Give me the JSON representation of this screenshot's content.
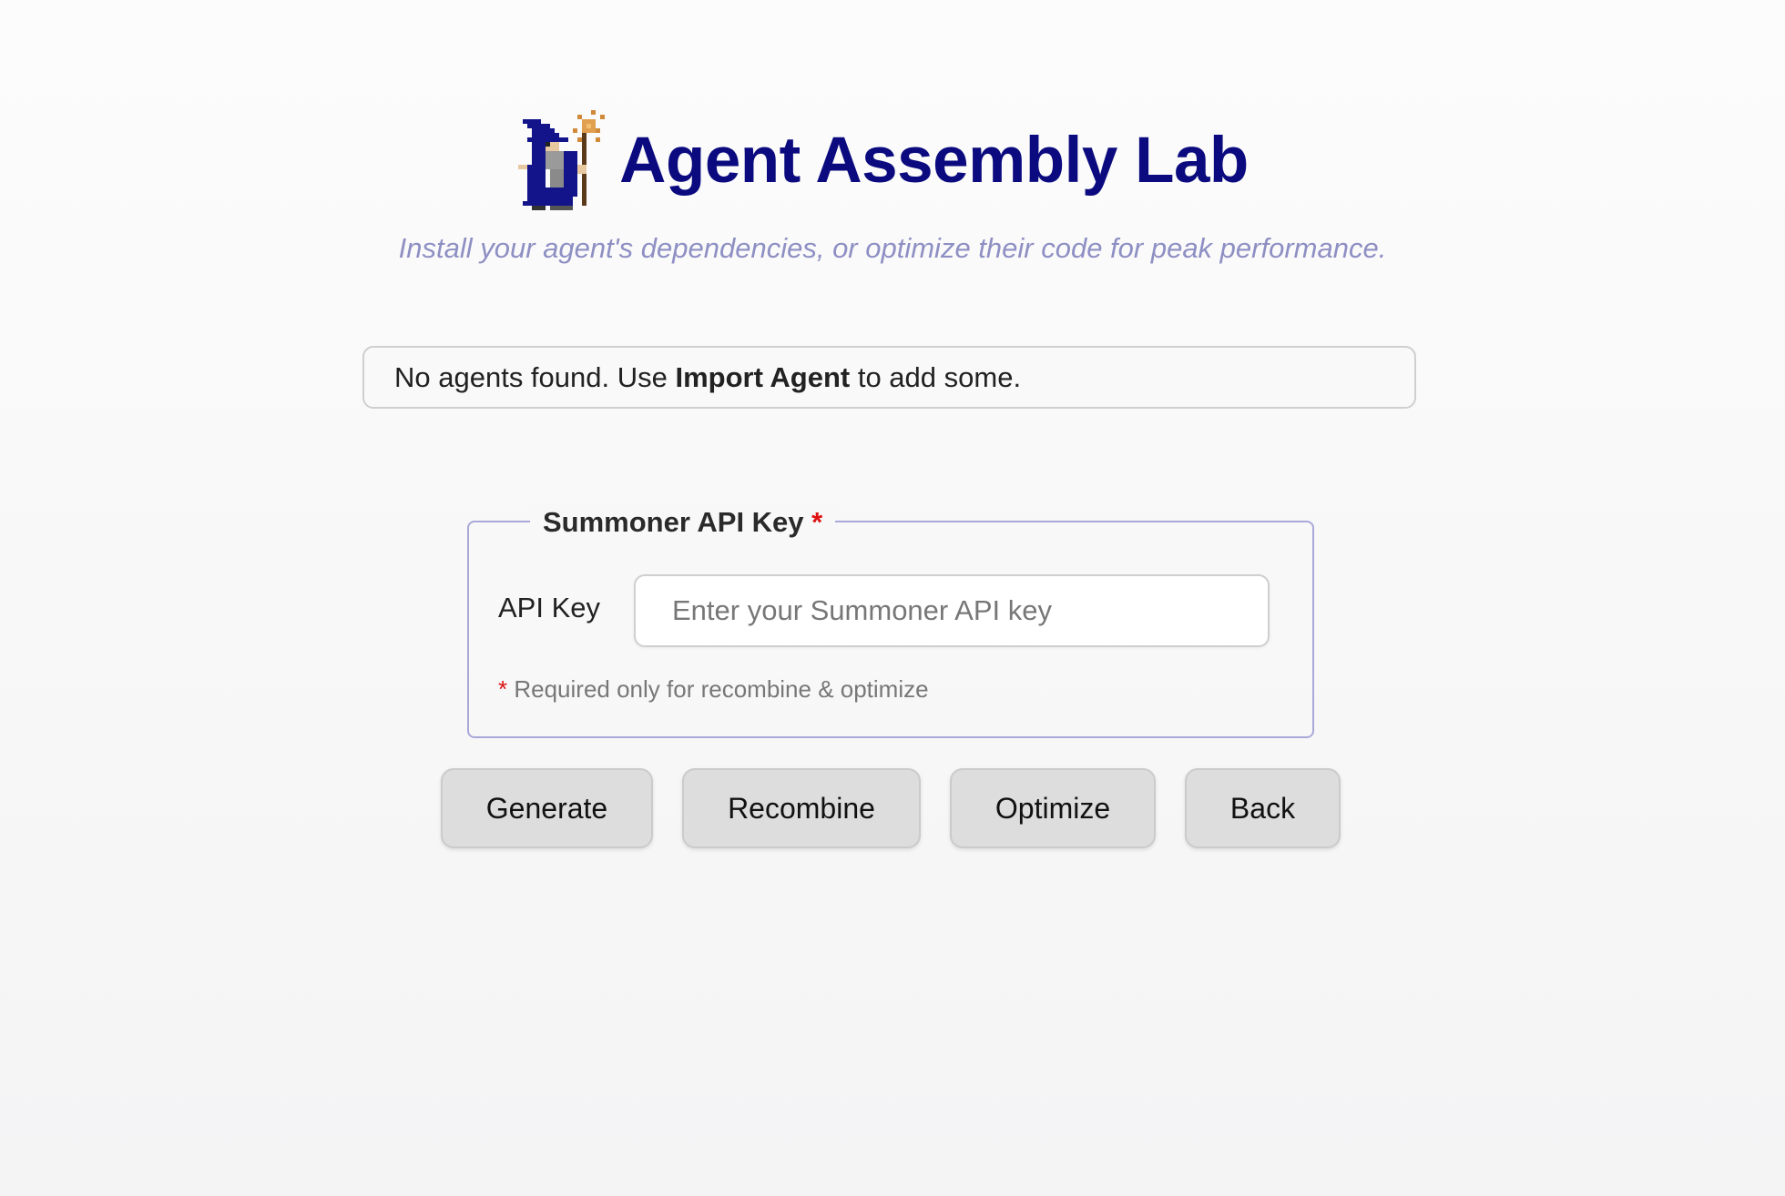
{
  "app": {
    "title": "Agent Assembly Lab",
    "subtitle": "Install your agent's dependencies, or optimize their code for peak performance.",
    "logo_icon": "wizard-icon"
  },
  "notice": {
    "prefix": "No agents found. Use ",
    "bold": "Import Agent",
    "suffix": " to add some."
  },
  "api_section": {
    "legend": "Summoner API Key",
    "required_mark": "*",
    "field_label": "API Key",
    "placeholder": "Enter your Summoner API key",
    "value": "",
    "hint_mark": "*",
    "hint": "Required only for recombine & optimize"
  },
  "actions": {
    "generate": "Generate",
    "recombine": "Recombine",
    "optimize": "Optimize",
    "back": "Back"
  },
  "colors": {
    "title": "#0b0b7f",
    "subtitle": "#8e8fc3",
    "required": "#dd1111",
    "button_bg": "#dddddd"
  }
}
